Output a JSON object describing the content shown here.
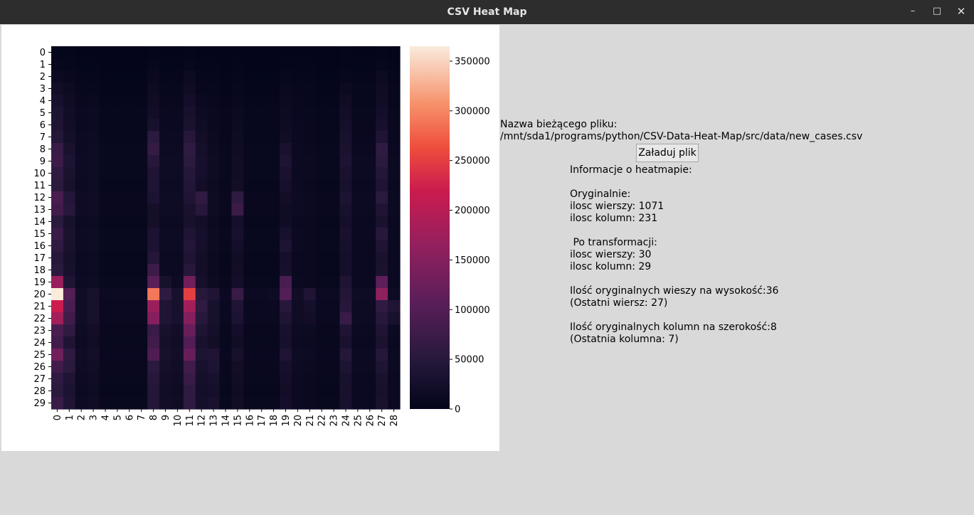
{
  "window": {
    "title": "CSV Heat Map",
    "controls": {
      "minimize": "–",
      "maximize": "□",
      "close": "✕"
    }
  },
  "file": {
    "label": "Nazwa bieżącego pliku:",
    "path": "/mnt/sda1/programs/python/CSV-Data-Heat-Map/src/data/new_cases.csv",
    "load_button": "Załaduj plik"
  },
  "info": {
    "heading": "Informacje o heatmapie:",
    "original_heading": "Oryginalnie:",
    "original_rows": "ilosc wierszy: 1071",
    "original_cols": "ilosc kolumn: 231",
    "transformed_heading": " Po transformacji:",
    "transformed_rows": "ilosc wierszy: 30",
    "transformed_cols": "ilosc kolumn: 29",
    "rows_per_cell": "Ilość oryginalnych wieszy na wysokość:36",
    "last_row": "(Ostatni wiersz: 27)",
    "cols_per_cell": "Ilość oryginalnych kolumn na szerokość:8",
    "last_col": "(Ostatnia kolumna: 7)"
  },
  "chart_data": {
    "type": "heatmap",
    "colormap": "rocket",
    "x_ticks": [
      "0",
      "1",
      "2",
      "3",
      "4",
      "5",
      "6",
      "7",
      "8",
      "9",
      "10",
      "11",
      "12",
      "13",
      "14",
      "15",
      "16",
      "17",
      "18",
      "19",
      "20",
      "21",
      "22",
      "23",
      "24",
      "25",
      "26",
      "27",
      "28"
    ],
    "y_ticks": [
      "0",
      "1",
      "2",
      "3",
      "4",
      "5",
      "6",
      "7",
      "8",
      "9",
      "10",
      "11",
      "12",
      "13",
      "14",
      "15",
      "16",
      "17",
      "18",
      "19",
      "20",
      "21",
      "22",
      "23",
      "24",
      "25",
      "26",
      "27",
      "28",
      "29"
    ],
    "colorbar": {
      "min": 0,
      "max": 365000,
      "ticks": [
        0,
        50000,
        100000,
        150000,
        200000,
        250000,
        300000,
        350000
      ],
      "tick_labels": [
        "0",
        "50000",
        "100000",
        "150000",
        "200000",
        "250000",
        "300000",
        "350000"
      ]
    },
    "values": [
      [
        2000,
        2000,
        1000,
        1000,
        1000,
        1000,
        1000,
        1000,
        2000,
        1000,
        1000,
        2000,
        1000,
        1000,
        1000,
        1000,
        1000,
        1000,
        1000,
        1000,
        1000,
        1000,
        1000,
        1000,
        2000,
        1000,
        1000,
        2000,
        1000
      ],
      [
        5000,
        4000,
        2000,
        2000,
        1000,
        1000,
        1000,
        1000,
        5000,
        2000,
        2000,
        6000,
        2000,
        2000,
        1000,
        2000,
        1000,
        1000,
        1000,
        3000,
        2000,
        2000,
        1000,
        1000,
        3000,
        2000,
        2000,
        5000,
        2000
      ],
      [
        12000,
        9000,
        4000,
        4000,
        2000,
        2000,
        2000,
        2000,
        10000,
        4000,
        4000,
        14000,
        4000,
        4000,
        2000,
        4000,
        2000,
        2000,
        2000,
        6000,
        4000,
        4000,
        2000,
        2000,
        6000,
        4000,
        4000,
        14000,
        4000
      ],
      [
        22000,
        14000,
        6000,
        6000,
        3000,
        3000,
        3000,
        3000,
        14000,
        6000,
        6000,
        18000,
        6000,
        6000,
        3000,
        6000,
        3000,
        3000,
        3000,
        10000,
        6000,
        5000,
        3000,
        3000,
        12000,
        5000,
        5000,
        18000,
        5000
      ],
      [
        30000,
        18000,
        8000,
        10000,
        4000,
        4000,
        4000,
        4000,
        18000,
        8000,
        8000,
        24000,
        10000,
        8000,
        4000,
        9000,
        4000,
        4000,
        4000,
        12000,
        8000,
        6000,
        4000,
        4000,
        18000,
        6000,
        6000,
        20000,
        6000
      ],
      [
        36000,
        20000,
        10000,
        12000,
        5000,
        5000,
        5000,
        5000,
        22000,
        10000,
        10000,
        30000,
        14000,
        10000,
        5000,
        12000,
        5000,
        5000,
        5000,
        14000,
        9000,
        7000,
        5000,
        5000,
        22000,
        7000,
        7000,
        24000,
        7000
      ],
      [
        40000,
        22000,
        11000,
        13000,
        6000,
        6000,
        6000,
        6000,
        30000,
        11000,
        11000,
        34000,
        18000,
        11000,
        6000,
        14000,
        6000,
        6000,
        6000,
        16000,
        10000,
        8000,
        6000,
        6000,
        26000,
        8000,
        8000,
        28000,
        8000
      ],
      [
        46000,
        25000,
        12000,
        14000,
        6000,
        6000,
        6000,
        6000,
        55000,
        12000,
        12000,
        50000,
        22000,
        12000,
        6000,
        16000,
        6000,
        6000,
        6000,
        20000,
        11000,
        9000,
        6000,
        6000,
        30000,
        9000,
        9000,
        40000,
        9000
      ],
      [
        70000,
        32000,
        13000,
        15000,
        7000,
        7000,
        7000,
        7000,
        65000,
        14000,
        14000,
        60000,
        26000,
        14000,
        7000,
        18000,
        7000,
        7000,
        7000,
        32000,
        12000,
        10000,
        7000,
        7000,
        34000,
        10000,
        10000,
        60000,
        10000
      ],
      [
        75000,
        36000,
        14000,
        16000,
        7000,
        7000,
        7000,
        7000,
        50000,
        15000,
        15000,
        55000,
        28000,
        15000,
        7000,
        20000,
        7000,
        7000,
        7000,
        36000,
        13000,
        12000,
        7000,
        7000,
        36000,
        12000,
        12000,
        55000,
        12000
      ],
      [
        60000,
        34000,
        14000,
        16000,
        7000,
        7000,
        7000,
        7000,
        40000,
        15000,
        15000,
        48000,
        26000,
        15000,
        7000,
        20000,
        7000,
        7000,
        7000,
        32000,
        13000,
        12000,
        7000,
        7000,
        32000,
        12000,
        12000,
        45000,
        12000
      ],
      [
        55000,
        30000,
        13000,
        15000,
        6000,
        6000,
        6000,
        6000,
        38000,
        14000,
        14000,
        44000,
        22000,
        14000,
        6000,
        22000,
        6000,
        6000,
        6000,
        28000,
        12000,
        11000,
        6000,
        6000,
        30000,
        11000,
        11000,
        40000,
        11000
      ],
      [
        90000,
        45000,
        15000,
        18000,
        8000,
        8000,
        8000,
        8000,
        35000,
        16000,
        16000,
        40000,
        60000,
        16000,
        8000,
        60000,
        8000,
        8000,
        8000,
        22000,
        14000,
        12000,
        8000,
        8000,
        36000,
        12000,
        12000,
        55000,
        12000
      ],
      [
        80000,
        50000,
        15000,
        18000,
        8000,
        8000,
        8000,
        8000,
        25000,
        16000,
        16000,
        32000,
        50000,
        16000,
        8000,
        75000,
        8000,
        8000,
        8000,
        18000,
        14000,
        12000,
        8000,
        8000,
        30000,
        12000,
        12000,
        40000,
        12000
      ],
      [
        55000,
        30000,
        12000,
        14000,
        6000,
        6000,
        6000,
        6000,
        25000,
        12000,
        12000,
        30000,
        22000,
        12000,
        6000,
        26000,
        6000,
        6000,
        6000,
        18000,
        11000,
        10000,
        6000,
        6000,
        26000,
        10000,
        10000,
        32000,
        10000
      ],
      [
        70000,
        34000,
        14000,
        16000,
        7000,
        7000,
        7000,
        7000,
        35000,
        14000,
        14000,
        40000,
        26000,
        14000,
        7000,
        30000,
        7000,
        7000,
        7000,
        30000,
        13000,
        11000,
        7000,
        7000,
        32000,
        11000,
        11000,
        50000,
        11000
      ],
      [
        60000,
        32000,
        14000,
        16000,
        7000,
        7000,
        7000,
        7000,
        35000,
        14000,
        14000,
        45000,
        26000,
        14000,
        7000,
        24000,
        7000,
        7000,
        7000,
        36000,
        13000,
        11000,
        7000,
        7000,
        28000,
        11000,
        11000,
        40000,
        11000
      ],
      [
        50000,
        28000,
        12000,
        14000,
        6000,
        6000,
        6000,
        6000,
        45000,
        12000,
        12000,
        40000,
        22000,
        12000,
        6000,
        20000,
        6000,
        6000,
        6000,
        26000,
        11000,
        10000,
        6000,
        6000,
        26000,
        10000,
        10000,
        32000,
        10000
      ],
      [
        55000,
        30000,
        12000,
        14000,
        6000,
        6000,
        6000,
        6000,
        75000,
        12000,
        12000,
        50000,
        22000,
        12000,
        6000,
        22000,
        6000,
        6000,
        6000,
        28000,
        11000,
        10000,
        6000,
        6000,
        26000,
        10000,
        10000,
        34000,
        10000
      ],
      [
        170000,
        40000,
        14000,
        16000,
        7000,
        7000,
        7000,
        7000,
        105000,
        30000,
        14000,
        130000,
        26000,
        14000,
        7000,
        24000,
        7000,
        7000,
        7000,
        90000,
        13000,
        11000,
        7000,
        7000,
        40000,
        11000,
        11000,
        110000,
        11000
      ],
      [
        365000,
        100000,
        20000,
        30000,
        12000,
        12000,
        12000,
        12000,
        290000,
        60000,
        30000,
        250000,
        50000,
        40000,
        12000,
        70000,
        12000,
        12000,
        16000,
        100000,
        20000,
        40000,
        12000,
        12000,
        45000,
        16000,
        16000,
        160000,
        16000
      ],
      [
        220000,
        90000,
        20000,
        30000,
        10000,
        10000,
        10000,
        10000,
        170000,
        40000,
        30000,
        180000,
        60000,
        30000,
        10000,
        40000,
        10000,
        10000,
        10000,
        50000,
        18000,
        26000,
        10000,
        10000,
        50000,
        14000,
        14000,
        60000,
        40000
      ],
      [
        180000,
        80000,
        20000,
        30000,
        10000,
        10000,
        10000,
        10000,
        150000,
        40000,
        30000,
        150000,
        50000,
        30000,
        10000,
        35000,
        10000,
        10000,
        10000,
        40000,
        18000,
        22000,
        10000,
        10000,
        70000,
        14000,
        14000,
        50000,
        30000
      ],
      [
        90000,
        60000,
        16000,
        22000,
        8000,
        8000,
        8000,
        8000,
        70000,
        30000,
        22000,
        120000,
        40000,
        26000,
        8000,
        24000,
        8000,
        8000,
        8000,
        30000,
        14000,
        14000,
        8000,
        8000,
        40000,
        12000,
        12000,
        40000,
        12000
      ],
      [
        80000,
        40000,
        14000,
        20000,
        7000,
        7000,
        7000,
        7000,
        80000,
        26000,
        20000,
        100000,
        30000,
        22000,
        7000,
        20000,
        7000,
        7000,
        7000,
        28000,
        13000,
        12000,
        7000,
        7000,
        32000,
        11000,
        11000,
        34000,
        11000
      ],
      [
        130000,
        60000,
        18000,
        24000,
        9000,
        9000,
        9000,
        9000,
        95000,
        30000,
        22000,
        120000,
        36000,
        40000,
        9000,
        30000,
        9000,
        9000,
        9000,
        40000,
        16000,
        14000,
        9000,
        9000,
        46000,
        13000,
        13000,
        48000,
        13000
      ],
      [
        80000,
        55000,
        16000,
        20000,
        8000,
        8000,
        8000,
        8000,
        55000,
        26000,
        20000,
        80000,
        30000,
        36000,
        8000,
        22000,
        8000,
        8000,
        8000,
        28000,
        14000,
        12000,
        8000,
        8000,
        36000,
        12000,
        12000,
        38000,
        12000
      ],
      [
        60000,
        40000,
        14000,
        18000,
        7000,
        7000,
        7000,
        7000,
        50000,
        22000,
        18000,
        70000,
        26000,
        30000,
        7000,
        20000,
        7000,
        7000,
        7000,
        24000,
        13000,
        11000,
        7000,
        7000,
        30000,
        11000,
        11000,
        32000,
        11000
      ],
      [
        55000,
        35000,
        13000,
        16000,
        6000,
        6000,
        6000,
        6000,
        45000,
        20000,
        16000,
        60000,
        24000,
        26000,
        6000,
        18000,
        6000,
        6000,
        6000,
        22000,
        12000,
        10000,
        6000,
        6000,
        32000,
        10000,
        10000,
        30000,
        10000
      ],
      [
        70000,
        40000,
        14000,
        18000,
        7000,
        7000,
        7000,
        7000,
        45000,
        22000,
        18000,
        60000,
        26000,
        32000,
        7000,
        20000,
        7000,
        7000,
        7000,
        24000,
        13000,
        11000,
        7000,
        7000,
        30000,
        11000,
        11000,
        32000,
        11000
      ]
    ]
  }
}
